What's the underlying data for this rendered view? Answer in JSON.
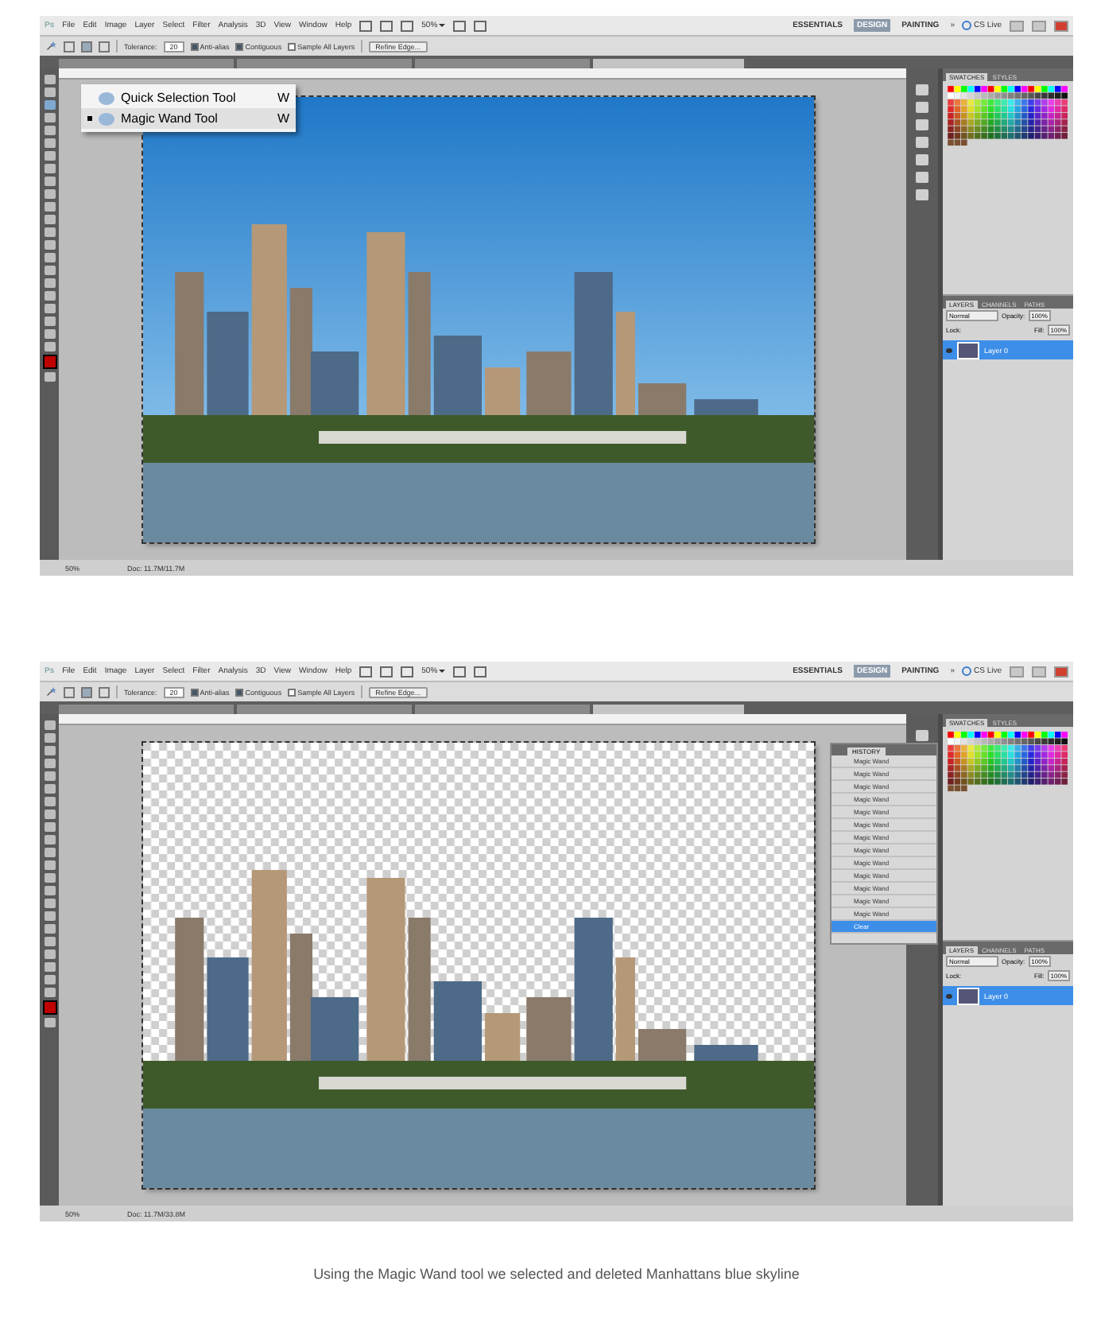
{
  "screenshots": [
    {
      "app_logo": "Ps",
      "menu": [
        "File",
        "Edit",
        "Image",
        "Layer",
        "Select",
        "Filter",
        "Analysis",
        "3D",
        "View",
        "Window",
        "Help"
      ],
      "zoom_menu": "50%",
      "options": {
        "tolerance_label": "Tolerance:",
        "tolerance": "20",
        "checkboxes": [
          {
            "label": "Anti-alias",
            "checked": true
          },
          {
            "label": "Contiguous",
            "checked": true
          },
          {
            "label": "Sample All Layers",
            "checked": false
          }
        ],
        "refine": "Refine Edge..."
      },
      "workspaces": [
        {
          "label": "ESSENTIALS",
          "selected": false
        },
        {
          "label": "DESIGN",
          "selected": true
        },
        {
          "label": "PAINTING",
          "selected": false
        }
      ],
      "more": "»",
      "cs_live": "CS Live",
      "doc_tabs": [
        {
          "selected": false
        },
        {
          "selected": false
        },
        {
          "selected": false
        },
        {
          "selected": true
        }
      ],
      "flyout": [
        {
          "label": "Quick Selection Tool",
          "shortcut": "W",
          "selected": false
        },
        {
          "label": "Magic Wand Tool",
          "shortcut": "W",
          "selected": true
        }
      ],
      "photo": {
        "transparent_background": false
      },
      "swatch_tabs": [
        {
          "label": "SWATCHES",
          "selected": true
        },
        {
          "label": "STYLES",
          "selected": false
        }
      ],
      "layers": {
        "tabs": [
          {
            "label": "LAYERS",
            "selected": true
          },
          {
            "label": "CHANNELS",
            "selected": false
          },
          {
            "label": "PATHS",
            "selected": false
          }
        ],
        "blend": "Normal",
        "opacity_label": "Opacity:",
        "opacity": "100%",
        "lock_label": "Lock:",
        "fill_label": "Fill:",
        "fill": "100%",
        "layer": "Layer 0"
      },
      "status": {
        "zoom": "50%",
        "doc": "Doc: 11.7M/11.7M"
      }
    },
    {
      "app_logo": "Ps",
      "menu": [
        "File",
        "Edit",
        "Image",
        "Layer",
        "Select",
        "Filter",
        "Analysis",
        "3D",
        "View",
        "Window",
        "Help"
      ],
      "zoom_menu": "50%",
      "options": {
        "tolerance_label": "Tolerance:",
        "tolerance": "20",
        "checkboxes": [
          {
            "label": "Anti-alias",
            "checked": true
          },
          {
            "label": "Contiguous",
            "checked": true
          },
          {
            "label": "Sample All Layers",
            "checked": false
          }
        ],
        "refine": "Refine Edge..."
      },
      "workspaces": [
        {
          "label": "ESSENTIALS",
          "selected": false
        },
        {
          "label": "DESIGN",
          "selected": true
        },
        {
          "label": "PAINTING",
          "selected": false
        }
      ],
      "more": "»",
      "cs_live": "CS Live",
      "doc_tabs": [
        {
          "selected": false
        },
        {
          "selected": false
        },
        {
          "selected": false
        },
        {
          "selected": true
        }
      ],
      "history": {
        "tab": "HISTORY",
        "items": [
          {
            "label": "Magic Wand",
            "selected": false
          },
          {
            "label": "Magic Wand",
            "selected": false
          },
          {
            "label": "Magic Wand",
            "selected": false
          },
          {
            "label": "Magic Wand",
            "selected": false
          },
          {
            "label": "Magic Wand",
            "selected": false
          },
          {
            "label": "Magic Wand",
            "selected": false
          },
          {
            "label": "Magic Wand",
            "selected": false
          },
          {
            "label": "Magic Wand",
            "selected": false
          },
          {
            "label": "Magic Wand",
            "selected": false
          },
          {
            "label": "Magic Wand",
            "selected": false
          },
          {
            "label": "Magic Wand",
            "selected": false
          },
          {
            "label": "Magic Wand",
            "selected": false
          },
          {
            "label": "Magic Wand",
            "selected": false
          },
          {
            "label": "Clear",
            "selected": true
          }
        ]
      },
      "photo": {
        "transparent_background": true
      },
      "swatch_tabs": [
        {
          "label": "SWATCHES",
          "selected": true
        },
        {
          "label": "STYLES",
          "selected": false
        }
      ],
      "layers": {
        "tabs": [
          {
            "label": "LAYERS",
            "selected": true
          },
          {
            "label": "CHANNELS",
            "selected": false
          },
          {
            "label": "PATHS",
            "selected": false
          }
        ],
        "blend": "Normal",
        "opacity_label": "Opacity:",
        "opacity": "100%",
        "lock_label": "Lock:",
        "fill_label": "Fill:",
        "fill": "100%",
        "layer": "Layer 0"
      },
      "status": {
        "zoom": "50%",
        "doc": "Doc: 11.7M/33.8M"
      }
    }
  ],
  "caption": "Using the Magic Wand tool we selected and deleted Manhattans blue skyline"
}
